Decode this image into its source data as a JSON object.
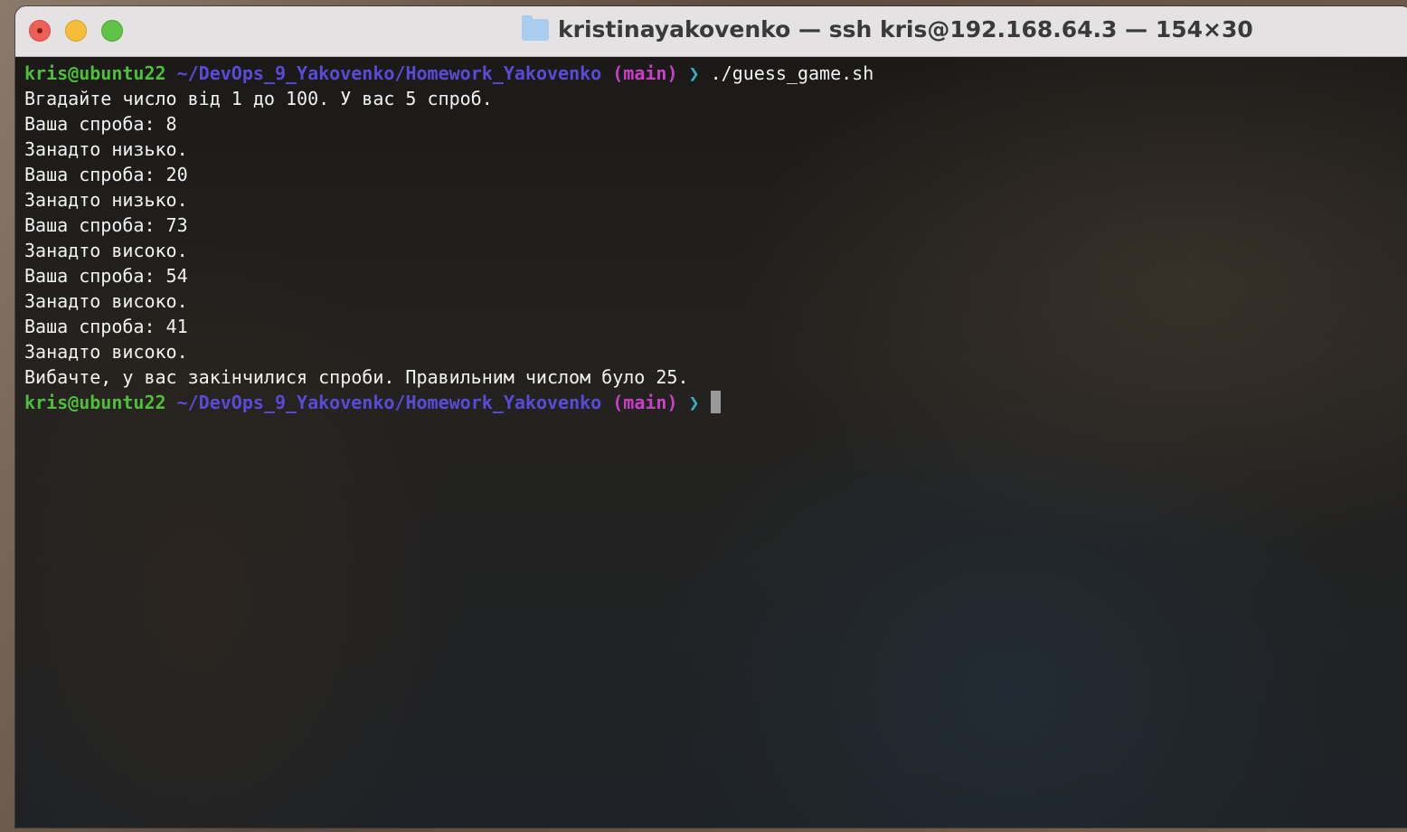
{
  "window": {
    "title": "kristinayakovenko — ssh kris@192.168.64.3 — 154×30"
  },
  "prompt": {
    "user": "kris@ubuntu22",
    "path": "~/DevOps_9_Yakovenko/Homework_Yakovenko",
    "branch": "(main)",
    "arrow": "❯"
  },
  "command": "./guess_game.sh",
  "output": [
    "Вгадайте число від 1 до 100. У вас 5 спроб.",
    "Ваша спроба: 8",
    "Занадто низько.",
    "Ваша спроба: 20",
    "Занадто низько.",
    "Ваша спроба: 73",
    "Занадто високо.",
    "Ваша спроба: 54",
    "Занадто високо.",
    "Ваша спроба: 41",
    "Занадто високо.",
    "Вибачте, у вас закінчилися спроби. Правильним числом було 25."
  ]
}
